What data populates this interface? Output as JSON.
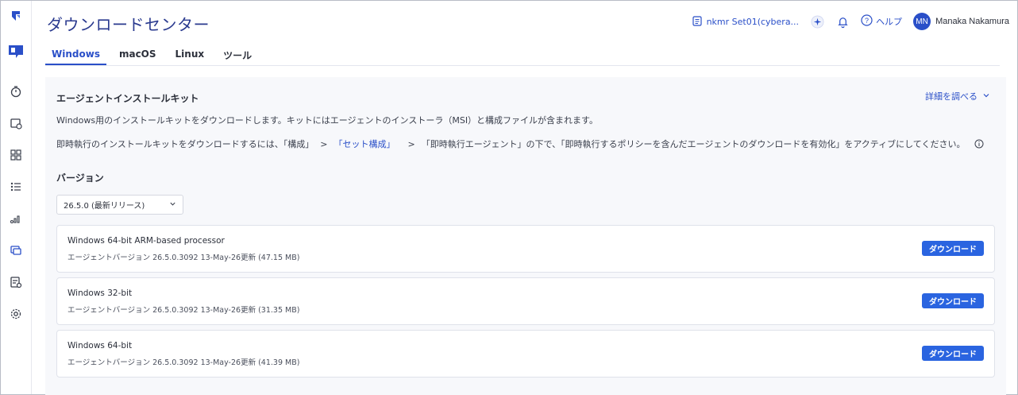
{
  "app": {
    "title": "ダウンロードセンター"
  },
  "tabs": [
    {
      "label": "Windows",
      "active": true
    },
    {
      "label": "macOS",
      "active": false
    },
    {
      "label": "Linux",
      "active": false
    },
    {
      "label": "ツール",
      "active": false
    }
  ],
  "topbar": {
    "org_name": "nkmr Set01(cybera...",
    "help_label": "ヘルプ",
    "user_initials": "MN",
    "user_name": "Manaka Nakamura"
  },
  "sidebar": {
    "icons": [
      "logo-icon",
      "dashboard-icon",
      "timer-icon",
      "calendar-check-icon",
      "apps-icon",
      "list-icon",
      "chart-icon",
      "devices-icon",
      "report-icon",
      "gear-icon"
    ],
    "active": "devices-icon"
  },
  "kit": {
    "title": "エージェントインストールキット",
    "learn_more": "詳細を調べる",
    "description": "Windows用のインストールキットをダウンロードします。キットにはエージェントのインストーラ（MSI）と構成ファイルが含まれます。",
    "note_prefix": "即時執行のインストールキットをダウンロードするには、「構成」",
    "note_sep1": ">",
    "note_link": "「セット構成」",
    "note_sep2": ">",
    "note_suffix": "「即時執行エージェント」の下で、「即時執行するポリシーを含んだエージェントのダウンロードを有効化」をアクティブにしてください。"
  },
  "version": {
    "label": "バージョン",
    "selected": "26.5.0 (最新リリース)"
  },
  "downloads": [
    {
      "title": "Windows 64-bit ARM-based processor",
      "detail": "エージェントバージョン 26.5.0.3092 13-May-26更新 (47.15 MB)",
      "button": "ダウンロード"
    },
    {
      "title": "Windows 32-bit",
      "detail": "エージェントバージョン 26.5.0.3092 13-May-26更新 (31.35 MB)",
      "button": "ダウンロード"
    },
    {
      "title": "Windows 64-bit",
      "detail": "エージェントバージョン 26.5.0.3092 13-May-26更新 (41.39 MB)",
      "button": "ダウンロード"
    }
  ],
  "colors": {
    "accent": "#2a4fc8",
    "button": "#2a64e0",
    "title": "#2a3a8f"
  }
}
